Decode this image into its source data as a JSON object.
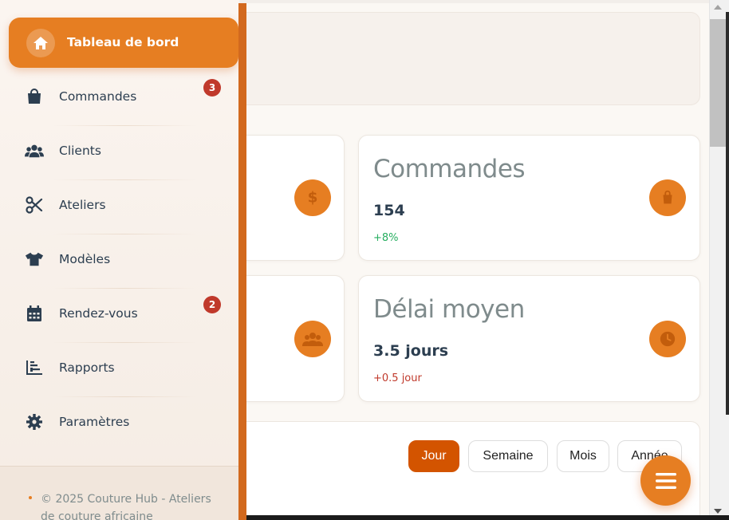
{
  "sidebar": {
    "active_item": {
      "label": "Tableau de bord",
      "icon": "home-icon"
    },
    "items": [
      {
        "label": "Commandes",
        "icon": "shopping-bag-icon",
        "badge": "3"
      },
      {
        "label": "Clients",
        "icon": "users-icon",
        "badge": ""
      },
      {
        "label": "Ateliers",
        "icon": "scissors-icon",
        "badge": ""
      },
      {
        "label": "Modèles",
        "icon": "tshirt-icon",
        "badge": ""
      },
      {
        "label": "Rendez-vous",
        "icon": "calendar-icon",
        "badge": "2"
      },
      {
        "label": "Rapports",
        "icon": "chart-bar-icon",
        "badge": ""
      },
      {
        "label": "Paramètres",
        "icon": "gear-icon",
        "badge": ""
      }
    ],
    "footer_text": "© 2025 Couture Hub - Ateliers de couture africaine"
  },
  "stats": {
    "orders": {
      "title": "Commandes",
      "value": "154",
      "delta": "+8%",
      "delta_color": "#27ae60",
      "icon": "shopping-bag-icon"
    },
    "avg_delay": {
      "title": "Délai moyen",
      "value": "3.5 jours",
      "delta": "+0.5 jour",
      "delta_color": "#c0392b",
      "icon": "clock-icon"
    },
    "revenue_partial": {
      "icon": "dollar-icon"
    },
    "clients_partial": {
      "icon": "users-icon"
    }
  },
  "period_filter": {
    "options": [
      "Jour",
      "Semaine",
      "Mois",
      "Année"
    ],
    "selected": "Jour"
  },
  "fab": {
    "icon": "menu-icon"
  },
  "colors": {
    "accent": "#e67e22",
    "accent_dark": "#d35400",
    "text_dark": "#2c3e50",
    "text_muted": "#7f8c8d",
    "badge": "#c0392b"
  }
}
